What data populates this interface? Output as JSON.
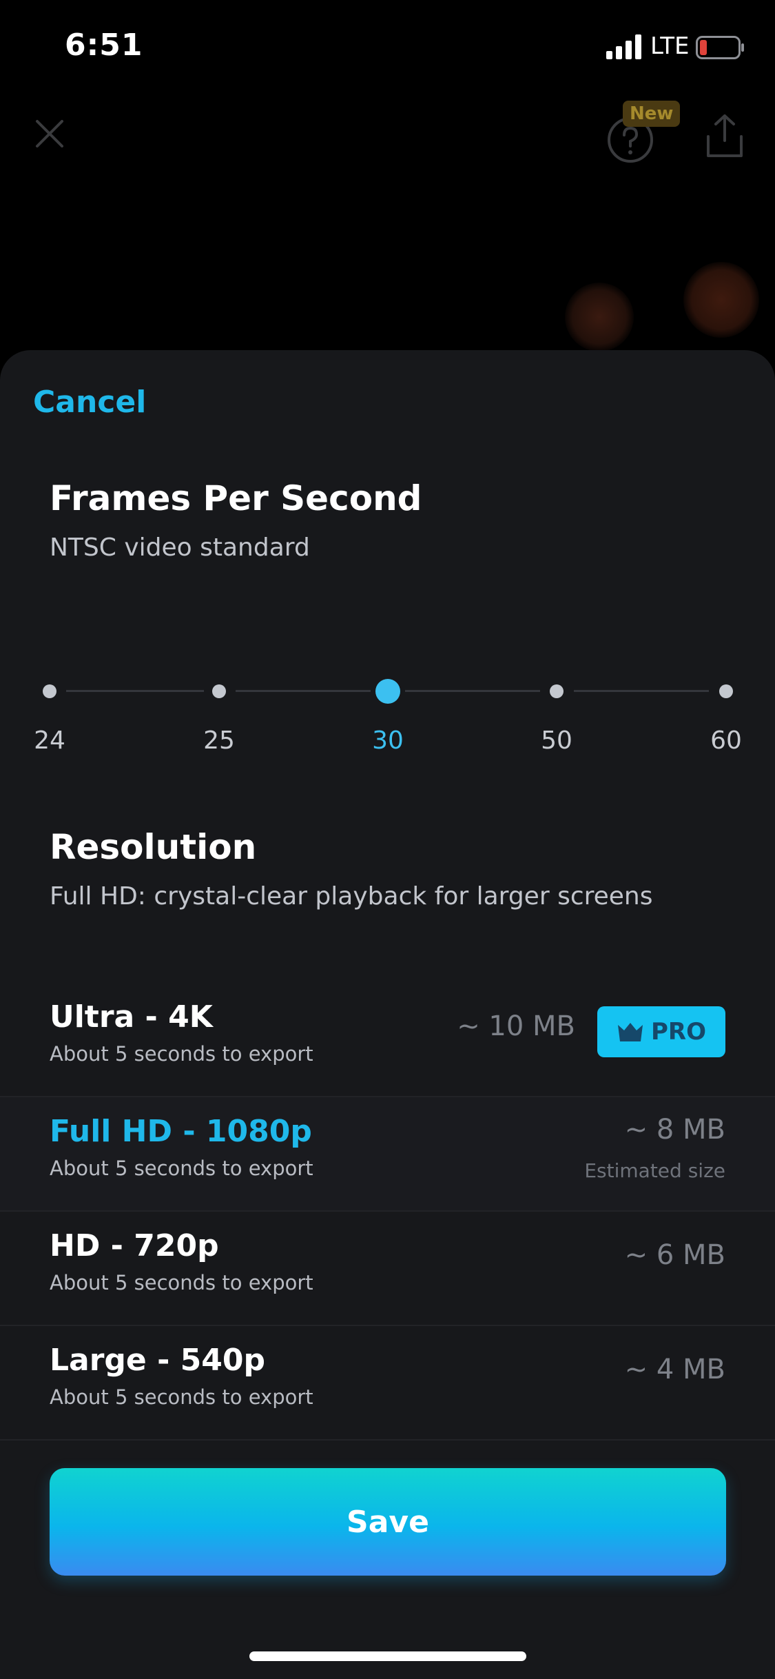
{
  "status_bar": {
    "time": "6:51",
    "network": "LTE"
  },
  "header": {
    "new_badge": "New"
  },
  "sheet": {
    "cancel_label": "Cancel",
    "fps": {
      "title": "Frames Per Second",
      "subtitle": "NTSC video standard",
      "options": [
        "24",
        "25",
        "30",
        "50",
        "60"
      ],
      "selected": "30"
    },
    "resolution": {
      "title": "Resolution",
      "subtitle": "Full HD: crystal-clear playback for larger screens",
      "items": [
        {
          "name": "Ultra - 4K",
          "time": "About 5 seconds to export",
          "size": "~ 10 MB",
          "badge": "PRO"
        },
        {
          "name": "Full HD - 1080p",
          "time": "About 5 seconds to export",
          "size": "~ 8 MB",
          "note": "Estimated size"
        },
        {
          "name": "HD - 720p",
          "time": "About 5 seconds to export",
          "size": "~ 6 MB"
        },
        {
          "name": "Large - 540p",
          "time": "About 5 seconds to export",
          "size": "~ 4 MB"
        }
      ],
      "selected": "Full HD - 1080p"
    },
    "save_label": "Save"
  },
  "colors": {
    "accent": "#1fb8ea",
    "sheet_bg": "#17181b",
    "pro_badge": "#15c3f2"
  }
}
